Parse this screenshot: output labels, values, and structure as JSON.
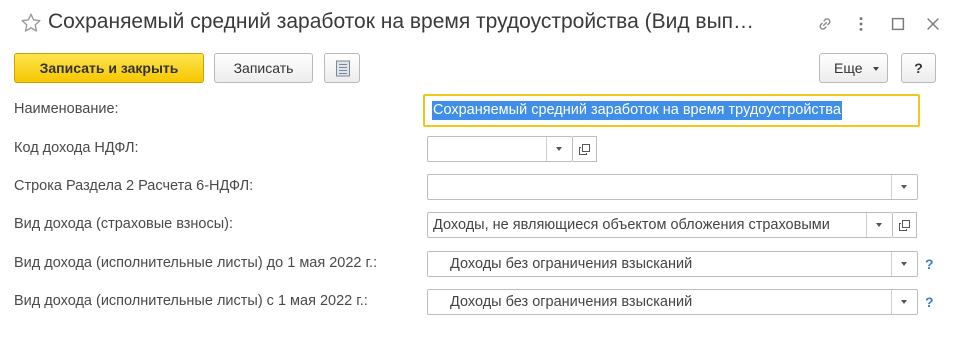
{
  "window": {
    "title": "Сохраняемый средний заработок на время трудоустройства (Вид вып…"
  },
  "icons": {
    "favorite": "star-icon",
    "link": "link-icon",
    "more": "more-vertical-icon",
    "maximize": "maximize-icon",
    "close": "close-icon",
    "report": "report-list-icon",
    "open": "open-form-icon"
  },
  "toolbar": {
    "save_close_label": "Записать и закрыть",
    "save_label": "Записать",
    "more_label": "Еще",
    "help_label": "?"
  },
  "form": {
    "name": {
      "label": "Наименование:",
      "value": "Сохраняемый средний заработок на время трудоустройства"
    },
    "ndfl_code": {
      "label": "Код дохода НДФЛ:",
      "value": ""
    },
    "line_6ndfl": {
      "label": "Строка Раздела 2 Расчета 6-НДФЛ:",
      "value": ""
    },
    "income_insurance": {
      "label": "Вид дохода (страховые взносы):",
      "value": "Доходы, не являющиеся объектом обложения страховыми"
    },
    "income_writs_before": {
      "label": "Вид дохода (исполнительные листы) до 1 мая 2022 г.:",
      "value": "Доходы без ограничения взысканий",
      "help": "?"
    },
    "income_writs_after": {
      "label": "Вид дохода (исполнительные листы) с 1 мая 2022 г.:",
      "value": "Доходы без ограничения взысканий",
      "help": "?"
    }
  },
  "colors": {
    "primary_button": "#f6c800",
    "focus_border": "#f2c71b",
    "selection": "#3f8ee7",
    "help_link": "#3b7fc4"
  }
}
